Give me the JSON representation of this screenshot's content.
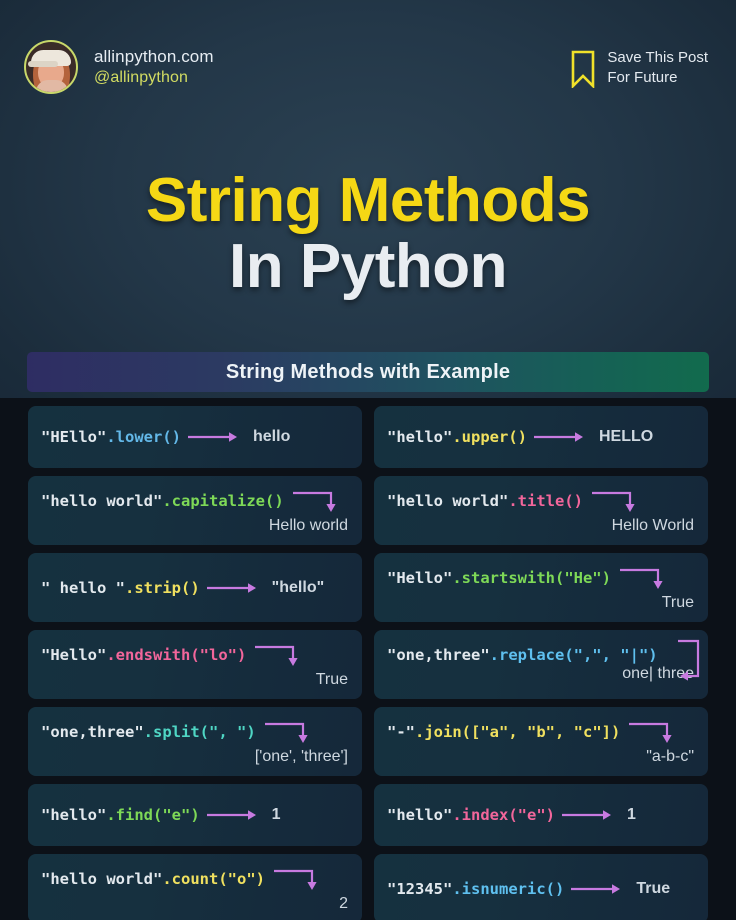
{
  "header": {
    "avatar_name": "profile-avatar",
    "site": "allinpython.com",
    "handle": "@allinpython",
    "save_line1": "Save This Post",
    "save_line2": "For Future",
    "bookmark_color": "#f0e12a"
  },
  "title": {
    "line1": "String Methods",
    "line2": "In Python",
    "line1_color": "#f5d815",
    "line2_color": "#e9edf1"
  },
  "banner": {
    "text": "String Methods with Example",
    "gradient_from": "#2e2d63",
    "gradient_to": "#126b4d"
  },
  "colors": {
    "background": "#233748",
    "grid_background": "#0c1118",
    "card_background": "#15303f",
    "arrow": "#c77ae0",
    "string_text": "#e3e9ee",
    "result_text": "#cfd8e0"
  },
  "cards": [
    {
      "name": "lower",
      "layout": "inline",
      "string": "\"HEllo\"",
      "method": ".lower",
      "method_color": "m-blue",
      "args": "()",
      "result": "hello"
    },
    {
      "name": "upper",
      "layout": "inline",
      "string": "\"hello\"",
      "method": ".upper",
      "method_color": "m-yellow",
      "args": "()",
      "result": "HELLO"
    },
    {
      "name": "capitalize",
      "layout": "stack",
      "string": "\"hello world\"",
      "method": ".capitalize",
      "method_color": "m-green",
      "args": "()",
      "result": "Hello world"
    },
    {
      "name": "title",
      "layout": "stack",
      "string": "\"hello world\"",
      "method": ".title",
      "method_color": "m-pink",
      "args": "()",
      "result": "Hello World"
    },
    {
      "name": "strip",
      "layout": "inline",
      "string": "\"  hello  \"",
      "method": ".strip",
      "method_color": "m-yellow",
      "args": "()",
      "result": "\"hello\""
    },
    {
      "name": "startswith",
      "layout": "stack",
      "string": "\"Hello\"",
      "method": ".startswith",
      "method_color": "m-green",
      "args": "(\"He\")",
      "result": "True"
    },
    {
      "name": "endswith",
      "layout": "stack",
      "string": "\"Hello\"",
      "method": ".endswith",
      "method_color": "m-pink",
      "args": "(\"lo\")",
      "result": "True"
    },
    {
      "name": "replace",
      "layout": "stack-back",
      "string": "\"one,three\"",
      "method": ".replace",
      "method_color": "m-ltblue",
      "args": "(\",\", \"|\")",
      "result": "one| three"
    },
    {
      "name": "split",
      "layout": "stack",
      "string": "\"one,three\"",
      "method": ".split",
      "method_color": "m-cyan",
      "args": "(\", \")",
      "result": "['one', 'three']"
    },
    {
      "name": "join",
      "layout": "stack",
      "string": "\"-\"",
      "method": ".join",
      "method_color": "m-yellow",
      "args": "([\"a\", \"b\", \"c\"])",
      "result": "\"a-b-c\""
    },
    {
      "name": "find",
      "layout": "inline",
      "string": "\"hello\"",
      "method": ".find",
      "method_color": "m-green",
      "args": "(\"e\")",
      "result": "1"
    },
    {
      "name": "index",
      "layout": "inline",
      "string": "\"hello\"",
      "method": ".index",
      "method_color": "m-pink",
      "args": "(\"e\")",
      "result": "1"
    },
    {
      "name": "count",
      "layout": "stack",
      "string": "\"hello world\"",
      "method": ".count",
      "method_color": "m-yellow",
      "args": "(\"o\")",
      "result": "2"
    },
    {
      "name": "isnumeric",
      "layout": "inline",
      "string": "\"12345\"",
      "method": ".isnumeric",
      "method_color": "m-ltblue",
      "args": "()",
      "result": "True"
    }
  ]
}
